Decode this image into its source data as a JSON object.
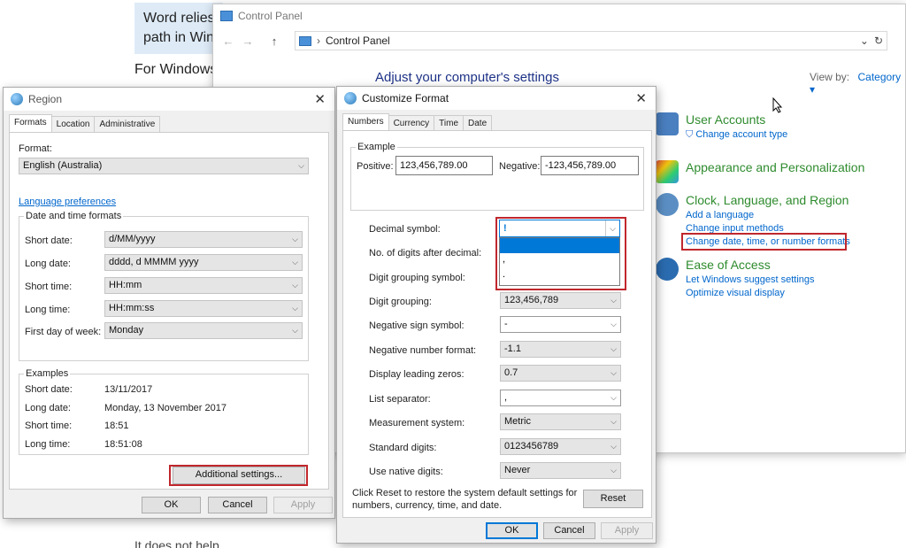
{
  "article": {
    "line1": "Word relies",
    "line2": "path in Win",
    "line3": "For Windows",
    "line4": "It does not help"
  },
  "control_panel": {
    "title": "Control Panel",
    "address": "Control Panel",
    "heading": "Adjust your computer's settings",
    "view_by_label": "View by:",
    "view_by_value": "Category",
    "categories": [
      {
        "title": "User Accounts",
        "links": [
          "Change account type"
        ]
      },
      {
        "title": "Appearance and Personalization",
        "links": []
      },
      {
        "title": "Clock, Language, and Region",
        "links": [
          "Add a language",
          "Change input methods",
          "Change date, time, or number formats"
        ]
      },
      {
        "title": "Ease of Access",
        "links": [
          "Let Windows suggest settings",
          "Optimize visual display"
        ]
      }
    ]
  },
  "region": {
    "title": "Region",
    "tabs": [
      "Formats",
      "Location",
      "Administrative"
    ],
    "format_label": "Format:",
    "format_value": "English (Australia)",
    "language_prefs": "Language preferences",
    "datetime_group": "Date and time formats",
    "rows": [
      {
        "label": "Short date:",
        "value": "d/MM/yyyy"
      },
      {
        "label": "Long date:",
        "value": "dddd, d MMMM yyyy"
      },
      {
        "label": "Short time:",
        "value": "HH:mm"
      },
      {
        "label": "Long time:",
        "value": "HH:mm:ss"
      },
      {
        "label": "First day of week:",
        "value": "Monday"
      }
    ],
    "examples_group": "Examples",
    "examples": [
      {
        "label": "Short date:",
        "value": "13/11/2017"
      },
      {
        "label": "Long date:",
        "value": "Monday, 13 November 2017"
      },
      {
        "label": "Short time:",
        "value": "18:51"
      },
      {
        "label": "Long time:",
        "value": "18:51:08"
      }
    ],
    "additional_settings": "Additional settings...",
    "ok": "OK",
    "cancel": "Cancel",
    "apply": "Apply"
  },
  "customize": {
    "title": "Customize Format",
    "tabs": [
      "Numbers",
      "Currency",
      "Time",
      "Date"
    ],
    "example_group": "Example",
    "positive_label": "Positive:",
    "positive_value": "123,456,789.00",
    "negative_label": "Negative:",
    "negative_value": "-123,456,789.00",
    "rows": [
      {
        "label": "Decimal symbol:",
        "value": ""
      },
      {
        "label": "No. of digits after decimal:",
        "value": ""
      },
      {
        "label": "Digit grouping symbol:",
        "value": ""
      },
      {
        "label": "Digit grouping:",
        "value": "123,456,789"
      },
      {
        "label": "Negative sign symbol:",
        "value": "-"
      },
      {
        "label": "Negative number format:",
        "value": "-1.1"
      },
      {
        "label": "Display leading zeros:",
        "value": "0.7"
      },
      {
        "label": "List separator:",
        "value": ","
      },
      {
        "label": "Measurement system:",
        "value": "Metric"
      },
      {
        "label": "Standard digits:",
        "value": "0123456789"
      },
      {
        "label": "Use native digits:",
        "value": "Never"
      }
    ],
    "decimal_input": "!",
    "decimal_options": [
      "",
      ",",
      "."
    ],
    "reset_note_1": "Click Reset to restore the system default settings for",
    "reset_note_2": "numbers, currency, time, and date.",
    "reset": "Reset",
    "ok": "OK",
    "cancel": "Cancel",
    "apply": "Apply"
  }
}
